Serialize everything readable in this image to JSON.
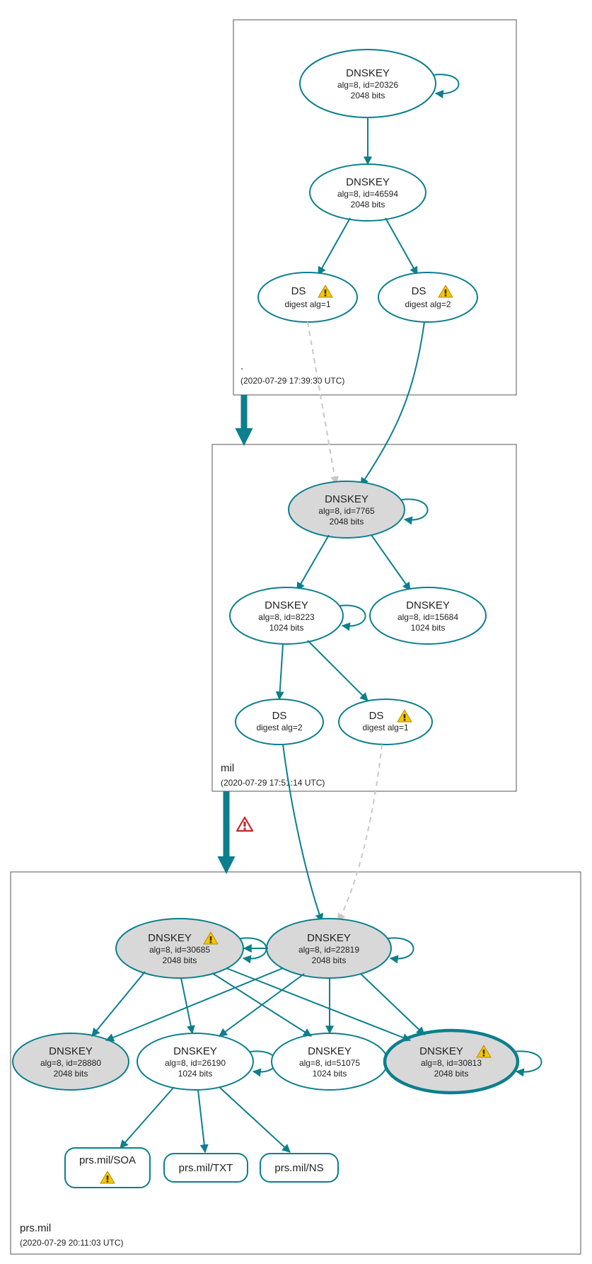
{
  "zones": {
    "root": {
      "label": ".",
      "timestamp": "(2020-07-29 17:39:30 UTC)"
    },
    "mil": {
      "label": "mil",
      "timestamp": "(2020-07-29 17:51:14 UTC)"
    },
    "prsmil": {
      "label": "prs.mil",
      "timestamp": "(2020-07-29 20:11:03 UTC)"
    }
  },
  "nodes": {
    "root_ksk": {
      "title": "DNSKEY",
      "l1": "alg=8, id=20326",
      "l2": "2048 bits"
    },
    "root_zsk": {
      "title": "DNSKEY",
      "l1": "alg=8, id=46594",
      "l2": "2048 bits"
    },
    "root_ds1": {
      "title": "DS",
      "l1": "digest alg=1"
    },
    "root_ds2": {
      "title": "DS",
      "l1": "digest alg=2"
    },
    "mil_ksk": {
      "title": "DNSKEY",
      "l1": "alg=8, id=7765",
      "l2": "2048 bits"
    },
    "mil_zsk1": {
      "title": "DNSKEY",
      "l1": "alg=8, id=8223",
      "l2": "1024 bits"
    },
    "mil_zsk2": {
      "title": "DNSKEY",
      "l1": "alg=8, id=15684",
      "l2": "1024 bits"
    },
    "mil_ds2": {
      "title": "DS",
      "l1": "digest alg=2"
    },
    "mil_ds1": {
      "title": "DS",
      "l1": "digest alg=1"
    },
    "prs_k30685": {
      "title": "DNSKEY",
      "l1": "alg=8, id=30685",
      "l2": "2048 bits"
    },
    "prs_k22819": {
      "title": "DNSKEY",
      "l1": "alg=8, id=22819",
      "l2": "2048 bits"
    },
    "prs_k28880": {
      "title": "DNSKEY",
      "l1": "alg=8, id=28880",
      "l2": "2048 bits"
    },
    "prs_k26190": {
      "title": "DNSKEY",
      "l1": "alg=8, id=26190",
      "l2": "1024 bits"
    },
    "prs_k51075": {
      "title": "DNSKEY",
      "l1": "alg=8, id=51075",
      "l2": "1024 bits"
    },
    "prs_k30813": {
      "title": "DNSKEY",
      "l1": "alg=8, id=30813",
      "l2": "2048 bits"
    },
    "rr_soa": {
      "label": "prs.mil/SOA"
    },
    "rr_txt": {
      "label": "prs.mil/TXT"
    },
    "rr_ns": {
      "label": "prs.mil/NS"
    }
  },
  "chart_data": {
    "type": "graph",
    "description": "DNSSEC authentication/delegation graph for prs.mil, visualized as three nested zones (. → mil → prs.mil) with DNSKEY/DS nodes connected by signing edges.",
    "zones": [
      {
        "name": ".",
        "timestamp": "2020-07-29 17:39:30 UTC"
      },
      {
        "name": "mil",
        "timestamp": "2020-07-29 17:51:14 UTC"
      },
      {
        "name": "prs.mil",
        "timestamp": "2020-07-29 20:11:03 UTC"
      }
    ],
    "nodes": [
      {
        "id": "root_ksk",
        "zone": ".",
        "type": "DNSKEY",
        "alg": 8,
        "key_id": 20326,
        "bits": 2048,
        "role": "KSK-trust-anchor",
        "fill": "grey",
        "double_border": true,
        "self_loop": true
      },
      {
        "id": "root_zsk",
        "zone": ".",
        "type": "DNSKEY",
        "alg": 8,
        "key_id": 46594,
        "bits": 2048,
        "fill": "white"
      },
      {
        "id": "root_ds1",
        "zone": ".",
        "type": "DS",
        "digest_alg": 1,
        "fill": "white",
        "warning": true
      },
      {
        "id": "root_ds2",
        "zone": ".",
        "type": "DS",
        "digest_alg": 2,
        "fill": "white",
        "warning": true
      },
      {
        "id": "mil_ksk",
        "zone": "mil",
        "type": "DNSKEY",
        "alg": 8,
        "key_id": 7765,
        "bits": 2048,
        "fill": "grey",
        "self_loop": true
      },
      {
        "id": "mil_zsk1",
        "zone": "mil",
        "type": "DNSKEY",
        "alg": 8,
        "key_id": 8223,
        "bits": 1024,
        "fill": "white",
        "self_loop": true
      },
      {
        "id": "mil_zsk2",
        "zone": "mil",
        "type": "DNSKEY",
        "alg": 8,
        "key_id": 15684,
        "bits": 1024,
        "fill": "white"
      },
      {
        "id": "mil_ds2",
        "zone": "mil",
        "type": "DS",
        "digest_alg": 2,
        "fill": "white"
      },
      {
        "id": "mil_ds1",
        "zone": "mil",
        "type": "DS",
        "digest_alg": 1,
        "fill": "white",
        "warning": true
      },
      {
        "id": "prs_k30685",
        "zone": "prs.mil",
        "type": "DNSKEY",
        "alg": 8,
        "key_id": 30685,
        "bits": 2048,
        "fill": "grey",
        "warning": true,
        "self_loop": true
      },
      {
        "id": "prs_k22819",
        "zone": "prs.mil",
        "type": "DNSKEY",
        "alg": 8,
        "key_id": 22819,
        "bits": 2048,
        "fill": "grey",
        "self_loop": true
      },
      {
        "id": "prs_k28880",
        "zone": "prs.mil",
        "type": "DNSKEY",
        "alg": 8,
        "key_id": 28880,
        "bits": 2048,
        "fill": "grey"
      },
      {
        "id": "prs_k26190",
        "zone": "prs.mil",
        "type": "DNSKEY",
        "alg": 8,
        "key_id": 26190,
        "bits": 1024,
        "fill": "white",
        "self_loop": true
      },
      {
        "id": "prs_k51075",
        "zone": "prs.mil",
        "type": "DNSKEY",
        "alg": 8,
        "key_id": 51075,
        "bits": 1024,
        "fill": "white"
      },
      {
        "id": "prs_k30813",
        "zone": "prs.mil",
        "type": "DNSKEY",
        "alg": 8,
        "key_id": 30813,
        "bits": 2048,
        "fill": "grey",
        "warning": true,
        "thick_border": true,
        "self_loop": true
      },
      {
        "id": "rr_soa",
        "zone": "prs.mil",
        "type": "RRset",
        "label": "prs.mil/SOA",
        "warning": true
      },
      {
        "id": "rr_txt",
        "zone": "prs.mil",
        "type": "RRset",
        "label": "prs.mil/TXT"
      },
      {
        "id": "rr_ns",
        "zone": "prs.mil",
        "type": "RRset",
        "label": "prs.mil/NS"
      }
    ],
    "edges": [
      {
        "from": "root_ksk",
        "to": "root_zsk",
        "style": "solid"
      },
      {
        "from": "root_zsk",
        "to": "root_ds1",
        "style": "solid"
      },
      {
        "from": "root_zsk",
        "to": "root_ds2",
        "style": "solid"
      },
      {
        "from": "root_ds1",
        "to": "mil_ksk",
        "style": "dashed"
      },
      {
        "from": "root_ds2",
        "to": "mil_ksk",
        "style": "solid"
      },
      {
        "from": "mil_ksk",
        "to": "mil_zsk1",
        "style": "solid"
      },
      {
        "from": "mil_ksk",
        "to": "mil_zsk2",
        "style": "solid"
      },
      {
        "from": "mil_zsk1",
        "to": "mil_ds2",
        "style": "solid"
      },
      {
        "from": "mil_zsk1",
        "to": "mil_ds1",
        "style": "solid"
      },
      {
        "from": "mil_ds2",
        "to": "prs_k22819",
        "style": "solid"
      },
      {
        "from": "mil_ds1",
        "to": "prs_k22819",
        "style": "dashed"
      },
      {
        "from": "prs_k30685",
        "to": "prs_k28880",
        "style": "solid"
      },
      {
        "from": "prs_k30685",
        "to": "prs_k26190",
        "style": "solid"
      },
      {
        "from": "prs_k30685",
        "to": "prs_k51075",
        "style": "solid"
      },
      {
        "from": "prs_k30685",
        "to": "prs_k30813",
        "style": "solid"
      },
      {
        "from": "prs_k22819",
        "to": "prs_k28880",
        "style": "solid"
      },
      {
        "from": "prs_k22819",
        "to": "prs_k26190",
        "style": "solid"
      },
      {
        "from": "prs_k22819",
        "to": "prs_k51075",
        "style": "solid"
      },
      {
        "from": "prs_k22819",
        "to": "prs_k30813",
        "style": "solid"
      },
      {
        "from": "prs_k22819",
        "to": "prs_k30685",
        "style": "solid"
      },
      {
        "from": "prs_k26190",
        "to": "rr_soa",
        "style": "solid"
      },
      {
        "from": "prs_k26190",
        "to": "rr_txt",
        "style": "solid"
      },
      {
        "from": "prs_k26190",
        "to": "rr_ns",
        "style": "solid"
      }
    ],
    "zone_delegation_edges": [
      {
        "from_zone": ".",
        "to_zone": "mil",
        "style": "thick"
      },
      {
        "from_zone": "mil",
        "to_zone": "prs.mil",
        "style": "thick",
        "error": true
      }
    ]
  }
}
